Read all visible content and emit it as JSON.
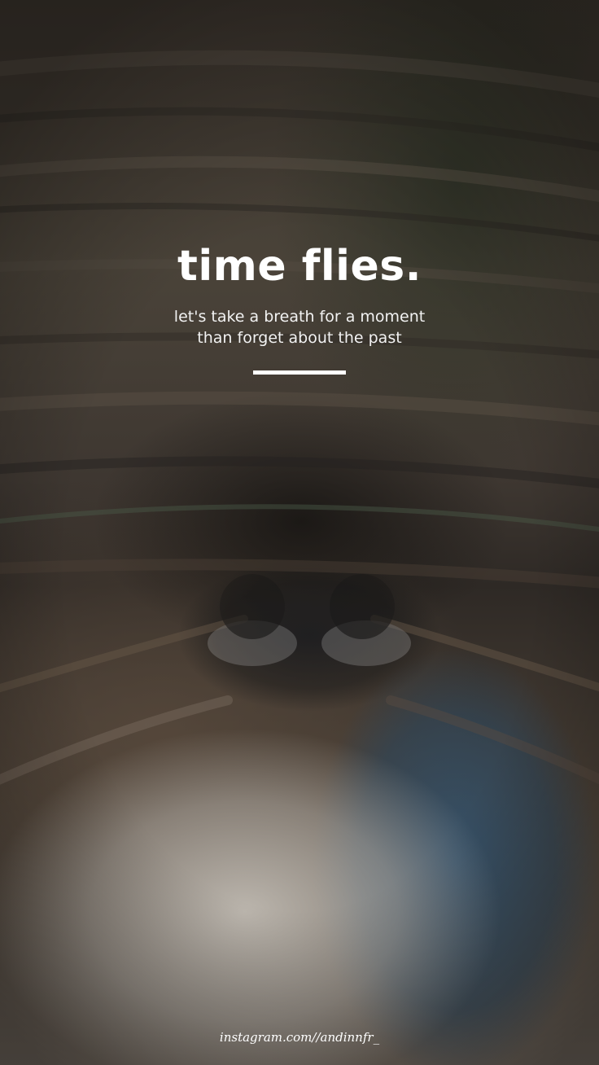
{
  "poster": {
    "title": "time flies.",
    "subtitle_line1": "let's take a breath for a moment",
    "subtitle_line2": "than forget about the past",
    "credit": "instagram.com//andinnfr_"
  },
  "colors": {
    "text": "#ffffff",
    "background_dark": "#3c352e",
    "jeans_blue": "#34526c",
    "fabric_light": "#cdc8c0"
  }
}
